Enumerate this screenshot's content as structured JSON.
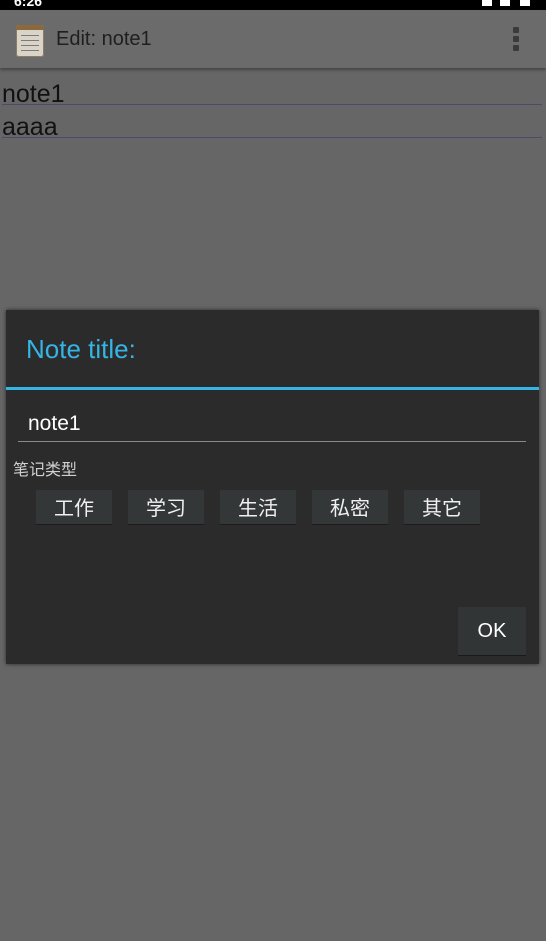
{
  "status_bar": {
    "time": "6:26"
  },
  "action_bar": {
    "title": "Edit: note1",
    "app_icon": "notepad-icon",
    "overflow_icon": "overflow-menu-icon"
  },
  "note": {
    "lines": [
      "note1",
      "aaaa"
    ]
  },
  "dialog": {
    "title": "Note title:",
    "input_value": "note1",
    "category_label": "笔记类型",
    "categories": [
      "工作",
      "学习",
      "生活",
      "私密",
      "其它"
    ],
    "ok_label": "OK"
  },
  "colors": {
    "accent": "#35b5e5",
    "dialog_bg": "#2b2b2b",
    "screen_dim": "#666666"
  }
}
